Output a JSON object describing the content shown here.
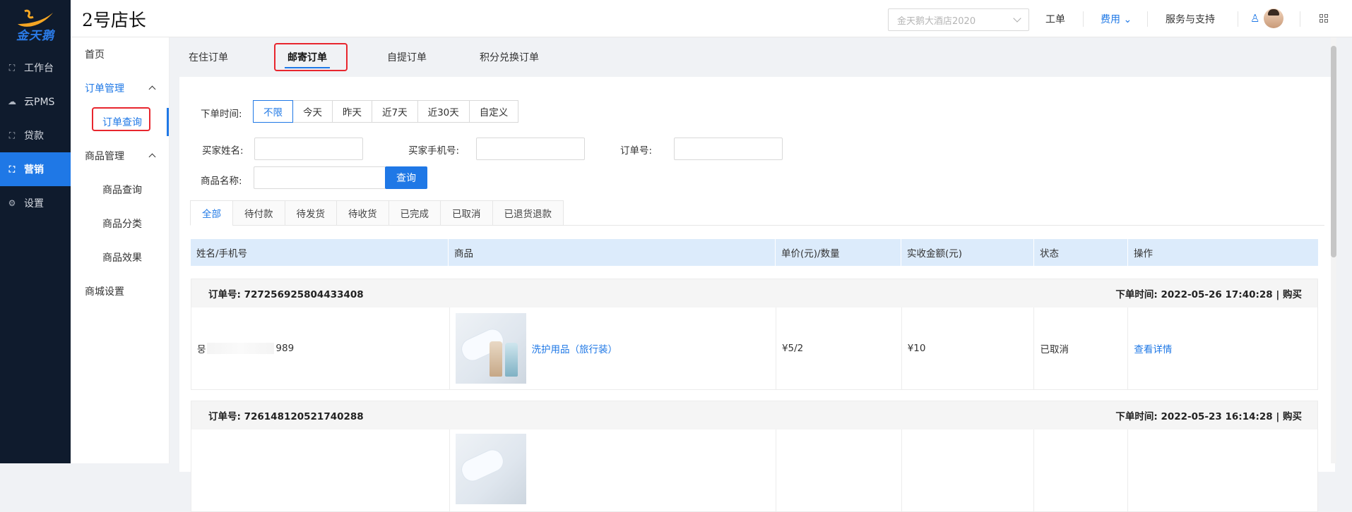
{
  "app": {
    "logo_text": "金天鹅",
    "brand_title": "2号店长",
    "colors": {
      "accent": "#1f78e6",
      "nav_bg": "#0f1b2d",
      "highlight": "#e8262e"
    }
  },
  "leftnav": {
    "items": [
      {
        "label": "工作台",
        "icon": "workbench-icon"
      },
      {
        "label": "云PMS",
        "icon": "cloud-icon"
      },
      {
        "label": "贷款",
        "icon": "loan-icon"
      },
      {
        "label": "营销",
        "icon": "marketing-icon",
        "active": true
      },
      {
        "label": "设置",
        "icon": "settings-icon"
      }
    ]
  },
  "header": {
    "hotel_placeholder": "金天鹅大酒店2020",
    "links": {
      "ticket": "工单",
      "fee": "费用",
      "support": "服务与支持"
    }
  },
  "subnav": {
    "home": "首页",
    "order_mgmt": "订单管理",
    "order_query": "订单查询",
    "goods_mgmt": "商品管理",
    "goods_query": "商品查询",
    "goods_category": "商品分类",
    "goods_effect": "商品效果",
    "mall_settings": "商城设置"
  },
  "tabs": [
    "在住订单",
    "邮寄订单",
    "自提订单",
    "积分兑换订单"
  ],
  "filters": {
    "time_label": "下单时间:",
    "time_options": [
      "不限",
      "今天",
      "昨天",
      "近7天",
      "近30天",
      "自定义"
    ],
    "buyer_name_label": "买家姓名:",
    "buyer_phone_label": "买家手机号:",
    "order_no_label": "订单号:",
    "goods_name_label": "商品名称:",
    "query_button": "查询"
  },
  "status_tabs": [
    "全部",
    "待付款",
    "待发货",
    "待收货",
    "已完成",
    "已取消",
    "已退货退款"
  ],
  "table": {
    "columns": [
      "姓名/手机号",
      "商品",
      "单价(元)/数量",
      "实收金额(元)",
      "状态",
      "操作"
    ]
  },
  "orders": [
    {
      "order_no": "订单号: 727256925804433408",
      "order_time": "下单时间: 2022-05-26 17:40:28 | 购买",
      "name_phone_prefix": "뭉",
      "name_phone_suffix": "989",
      "goods": "洗护用品（旅行装）",
      "price_qty": "¥5/2",
      "amount": "¥10",
      "status": "已取消",
      "action": "查看详情"
    },
    {
      "order_no": "订单号: 726148120521740288",
      "order_time": "下单时间: 2022-05-23 16:14:28 | 购买"
    }
  ]
}
